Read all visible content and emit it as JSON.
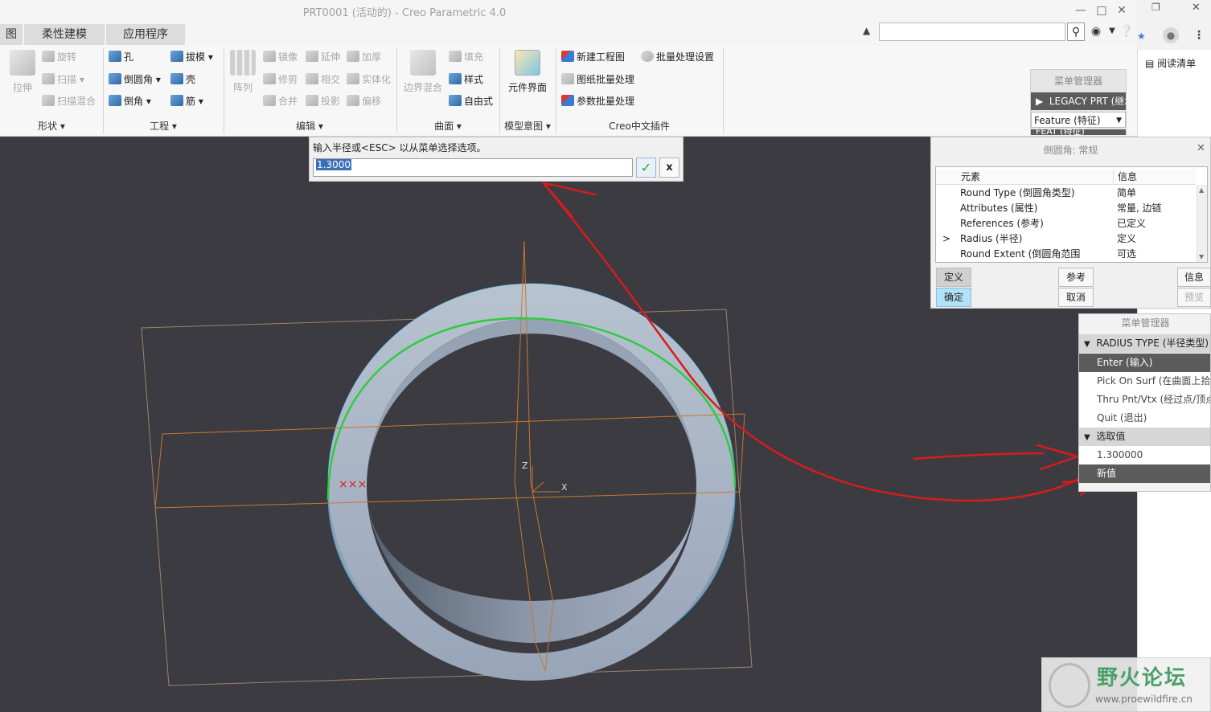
{
  "window": {
    "title": "PRT0001 (活动的) - Creo Parametric 4.0"
  },
  "tabs": [
    {
      "label": "图"
    },
    {
      "label": "柔性建模"
    },
    {
      "label": "应用程序"
    }
  ],
  "ribbon": {
    "shape": {
      "label": "形状",
      "buttons": {
        "extrude": "拉伸",
        "revolve": "旋转",
        "sweep": "扫描",
        "swept_blend": "扫描混合"
      }
    },
    "engineering": {
      "label": "工程",
      "buttons": {
        "hole": "孔",
        "draft": "拔模",
        "round": "倒圆角",
        "shell": "壳",
        "chamfer": "倒角",
        "rib": "筋"
      }
    },
    "editing": {
      "label": "编辑",
      "buttons": {
        "pattern": "阵列",
        "mirror": "镜像",
        "extend": "延伸",
        "thicken": "加厚",
        "trim": "修剪",
        "intersect": "相交",
        "solidify": "实体化",
        "merge": "合并",
        "project": "投影",
        "offset": "偏移"
      }
    },
    "surfaces": {
      "label": "曲面",
      "buttons": {
        "boundary_blend": "边界混合",
        "fill": "填充",
        "style": "样式",
        "freestyle": "自由式"
      }
    },
    "model_intent": {
      "label": "模型意图",
      "buttons": {
        "component_interface": "元件界面"
      }
    },
    "creo_plugin": {
      "label": "Creo中文插件",
      "buttons": {
        "new_drawing": "新建工程图",
        "batch_settings": "批量处理设置",
        "drawing_batch": "图纸批量处理",
        "param_batch": "参数批量处理"
      }
    }
  },
  "menu_manager_top": {
    "header": "菜单管理器",
    "item1": "LEGACY PRT (继承",
    "select_value": "Feature (特征)",
    "item2": "FEAT (特征)"
  },
  "browser_panel": {
    "reading_list": "阅读清单"
  },
  "input_dialog": {
    "prompt": "输入半径或<ESC> 以从菜单选择选项。",
    "value": "1.3000",
    "ok_icon": "checkmark-icon",
    "cancel_label": "x"
  },
  "round_dialog": {
    "title": "倒圆角: 常规",
    "columns": {
      "element": "元素",
      "info": "信息"
    },
    "rows": [
      {
        "marker": "",
        "element": "Round Type (倒圆角类型)",
        "info": "简单"
      },
      {
        "marker": "",
        "element": "Attributes (属性)",
        "info": "常量, 边链"
      },
      {
        "marker": "",
        "element": "References (参考)",
        "info": "已定义"
      },
      {
        "marker": ">",
        "element": "Radius (半径)",
        "info": "定义"
      },
      {
        "marker": "",
        "element": "Round Extent (倒圆角范围",
        "info": "可选"
      }
    ],
    "buttons": {
      "define": "定义",
      "reference": "参考",
      "info": "信息",
      "ok": "确定",
      "cancel": "取消",
      "preview": "预览"
    }
  },
  "menu_manager": {
    "header": "菜单管理器",
    "radius_type_header": "RADIUS TYPE (半径类型)",
    "items": [
      {
        "label": "Enter (输入)"
      },
      {
        "label": "Pick On Surf (在曲面上拾取"
      },
      {
        "label": "Thru Pnt/Vtx (经过点/顶点"
      },
      {
        "label": "Quit (退出)"
      }
    ],
    "select_value_header": "选取值",
    "values": [
      {
        "label": "1.300000"
      },
      {
        "label": "新值"
      }
    ]
  },
  "viewport": {
    "axis_z": "Z",
    "axis_x": "X",
    "marks": "×××"
  },
  "watermark": {
    "brand": "野火论坛",
    "url": "www.proewildfire.cn"
  },
  "colors": {
    "viewport_bg": "#3c3b42",
    "model_face": "#a3b1c4",
    "highlight_edge": "#2ecc40",
    "annotation_red": "#d61c1c",
    "datum_orange": "#c8782c",
    "ok_button_green": "#2aa23a"
  }
}
